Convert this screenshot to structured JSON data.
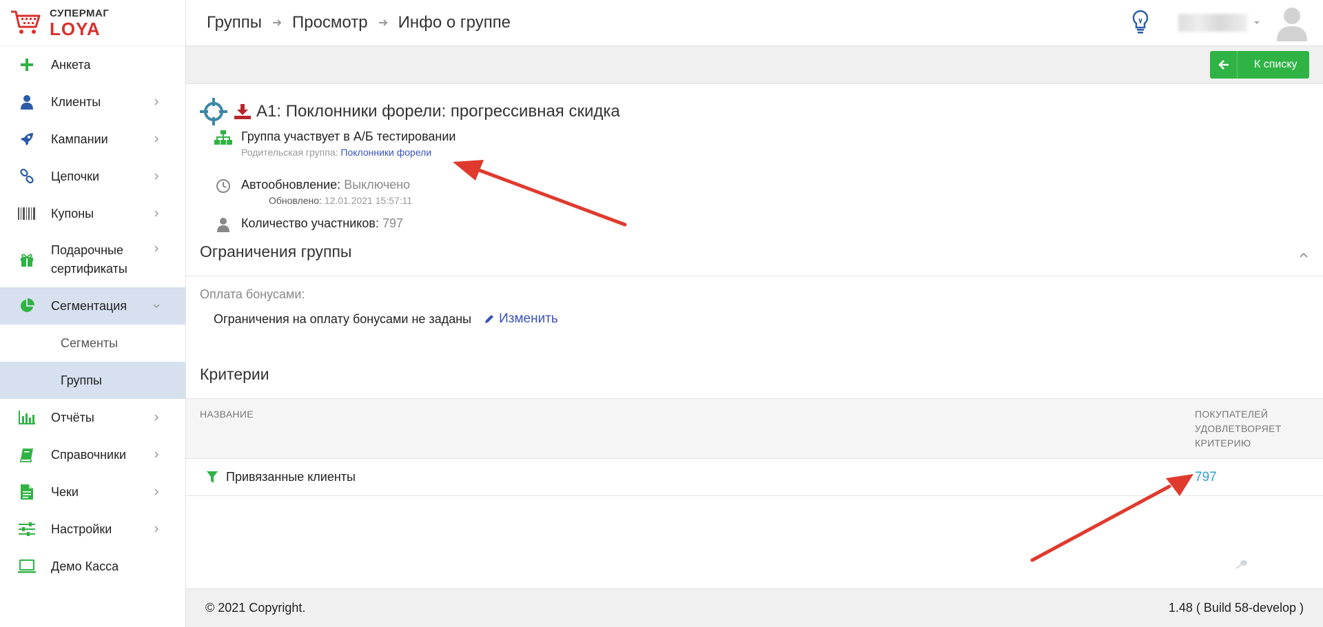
{
  "logo": {
    "top": "СУПЕРМАГ",
    "bottom": "LOYA"
  },
  "sidebar": {
    "items": [
      {
        "label": "Анкета"
      },
      {
        "label": "Клиенты"
      },
      {
        "label": "Кампании"
      },
      {
        "label": "Цепочки"
      },
      {
        "label": "Купоны"
      },
      {
        "label": "Подарочные сертификаты"
      },
      {
        "label": "Сегментация"
      },
      {
        "label": "Отчёты"
      },
      {
        "label": "Справочники"
      },
      {
        "label": "Чеки"
      },
      {
        "label": "Настройки"
      },
      {
        "label": "Демо Касса"
      }
    ],
    "subitems": [
      {
        "label": "Сегменты"
      },
      {
        "label": "Группы"
      }
    ]
  },
  "breadcrumb": [
    "Группы",
    "Просмотр",
    "Инфо о группе"
  ],
  "toolbar": {
    "back_label": "К списку"
  },
  "group": {
    "title": "A1: Поклонники форели: прогрессивная скидка",
    "ab_text": "Группа участвует в А/Б тестировании",
    "parent_label": "Родительская группа:",
    "parent_link": "Поклонники форели",
    "autoupdate_label": "Автообновление:",
    "autoupdate_value": "Выключено",
    "updated_label": "Обновлено:",
    "updated_value": "12.01.2021 15:57:11",
    "members_label": "Количество участников:",
    "members_value": "797"
  },
  "restrictions": {
    "title": "Ограничения группы",
    "bonus_label": "Оплата бонусами:",
    "bonus_text": "Ограничения на оплату бонусами не заданы",
    "edit_label": "Изменить"
  },
  "criteria": {
    "title": "Критерии",
    "col_name": "НАЗВАНИЕ",
    "col_count": "ПОКУПАТЕЛЕЙ УДОВЛЕТВОРЯЕТ КРИТЕРИЮ",
    "rows": [
      {
        "name": "Привязанные клиенты",
        "count": "797"
      }
    ]
  },
  "footer": {
    "copyright": "© 2021 Copyright.",
    "version": "1.48 ( Build 58-develop )"
  },
  "colors": {
    "accent_green": "#2fb344",
    "active_bg": "#d6e0ef",
    "link_blue": "#3a52b8",
    "count_blue": "#2a9fd8",
    "annotation_red": "#e03a2e"
  }
}
